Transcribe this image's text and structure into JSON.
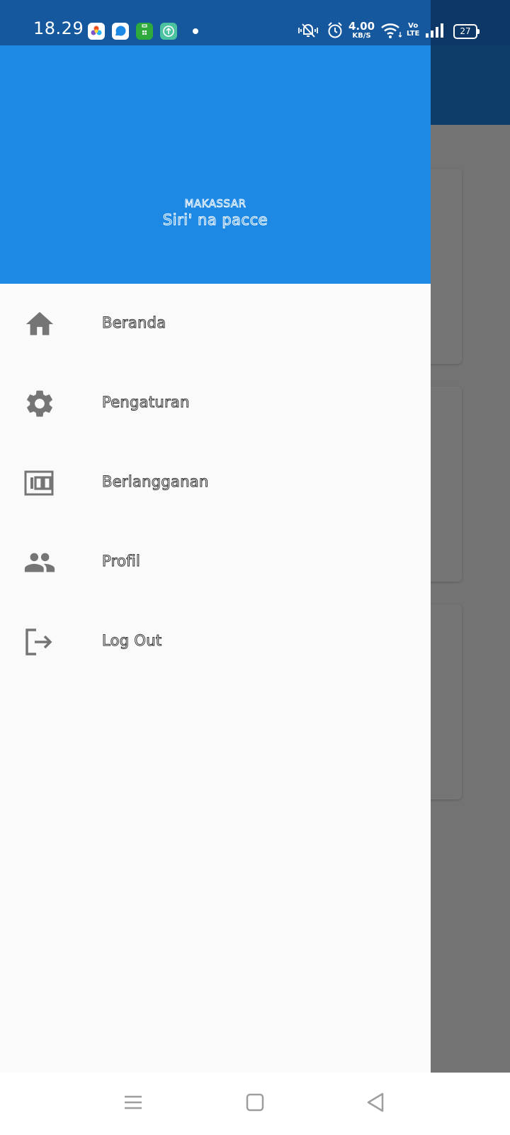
{
  "status_bar": {
    "time": "18.29",
    "net_speed_value": "4.00",
    "net_speed_unit": "KB/S",
    "volte_top": "Vo",
    "volte_bottom": "LTE",
    "battery_level": "27",
    "notification_icons": [
      "gallery-app-icon",
      "messenger-app-icon",
      "store-app-icon",
      "update-app-icon"
    ]
  },
  "drawer": {
    "header": {
      "region": "MAKASSAR",
      "motto": "Siri' na pacce",
      "background_color": "#1e88e5"
    },
    "items": [
      {
        "label": "Beranda",
        "icon": "home-icon"
      },
      {
        "label": "Pengaturan",
        "icon": "gear-icon"
      },
      {
        "label": "Berlangganan",
        "icon": "hundred-counter-icon"
      },
      {
        "label": "Profil",
        "icon": "people-icon"
      },
      {
        "label": "Log Out",
        "icon": "logout-icon"
      }
    ]
  },
  "nav_bar": {
    "buttons": [
      "menu-icon",
      "home-square-icon",
      "back-triangle-icon"
    ]
  },
  "colors": {
    "accent": "#1e88e5",
    "icon_gray": "#757575",
    "scrim": "#000000"
  }
}
